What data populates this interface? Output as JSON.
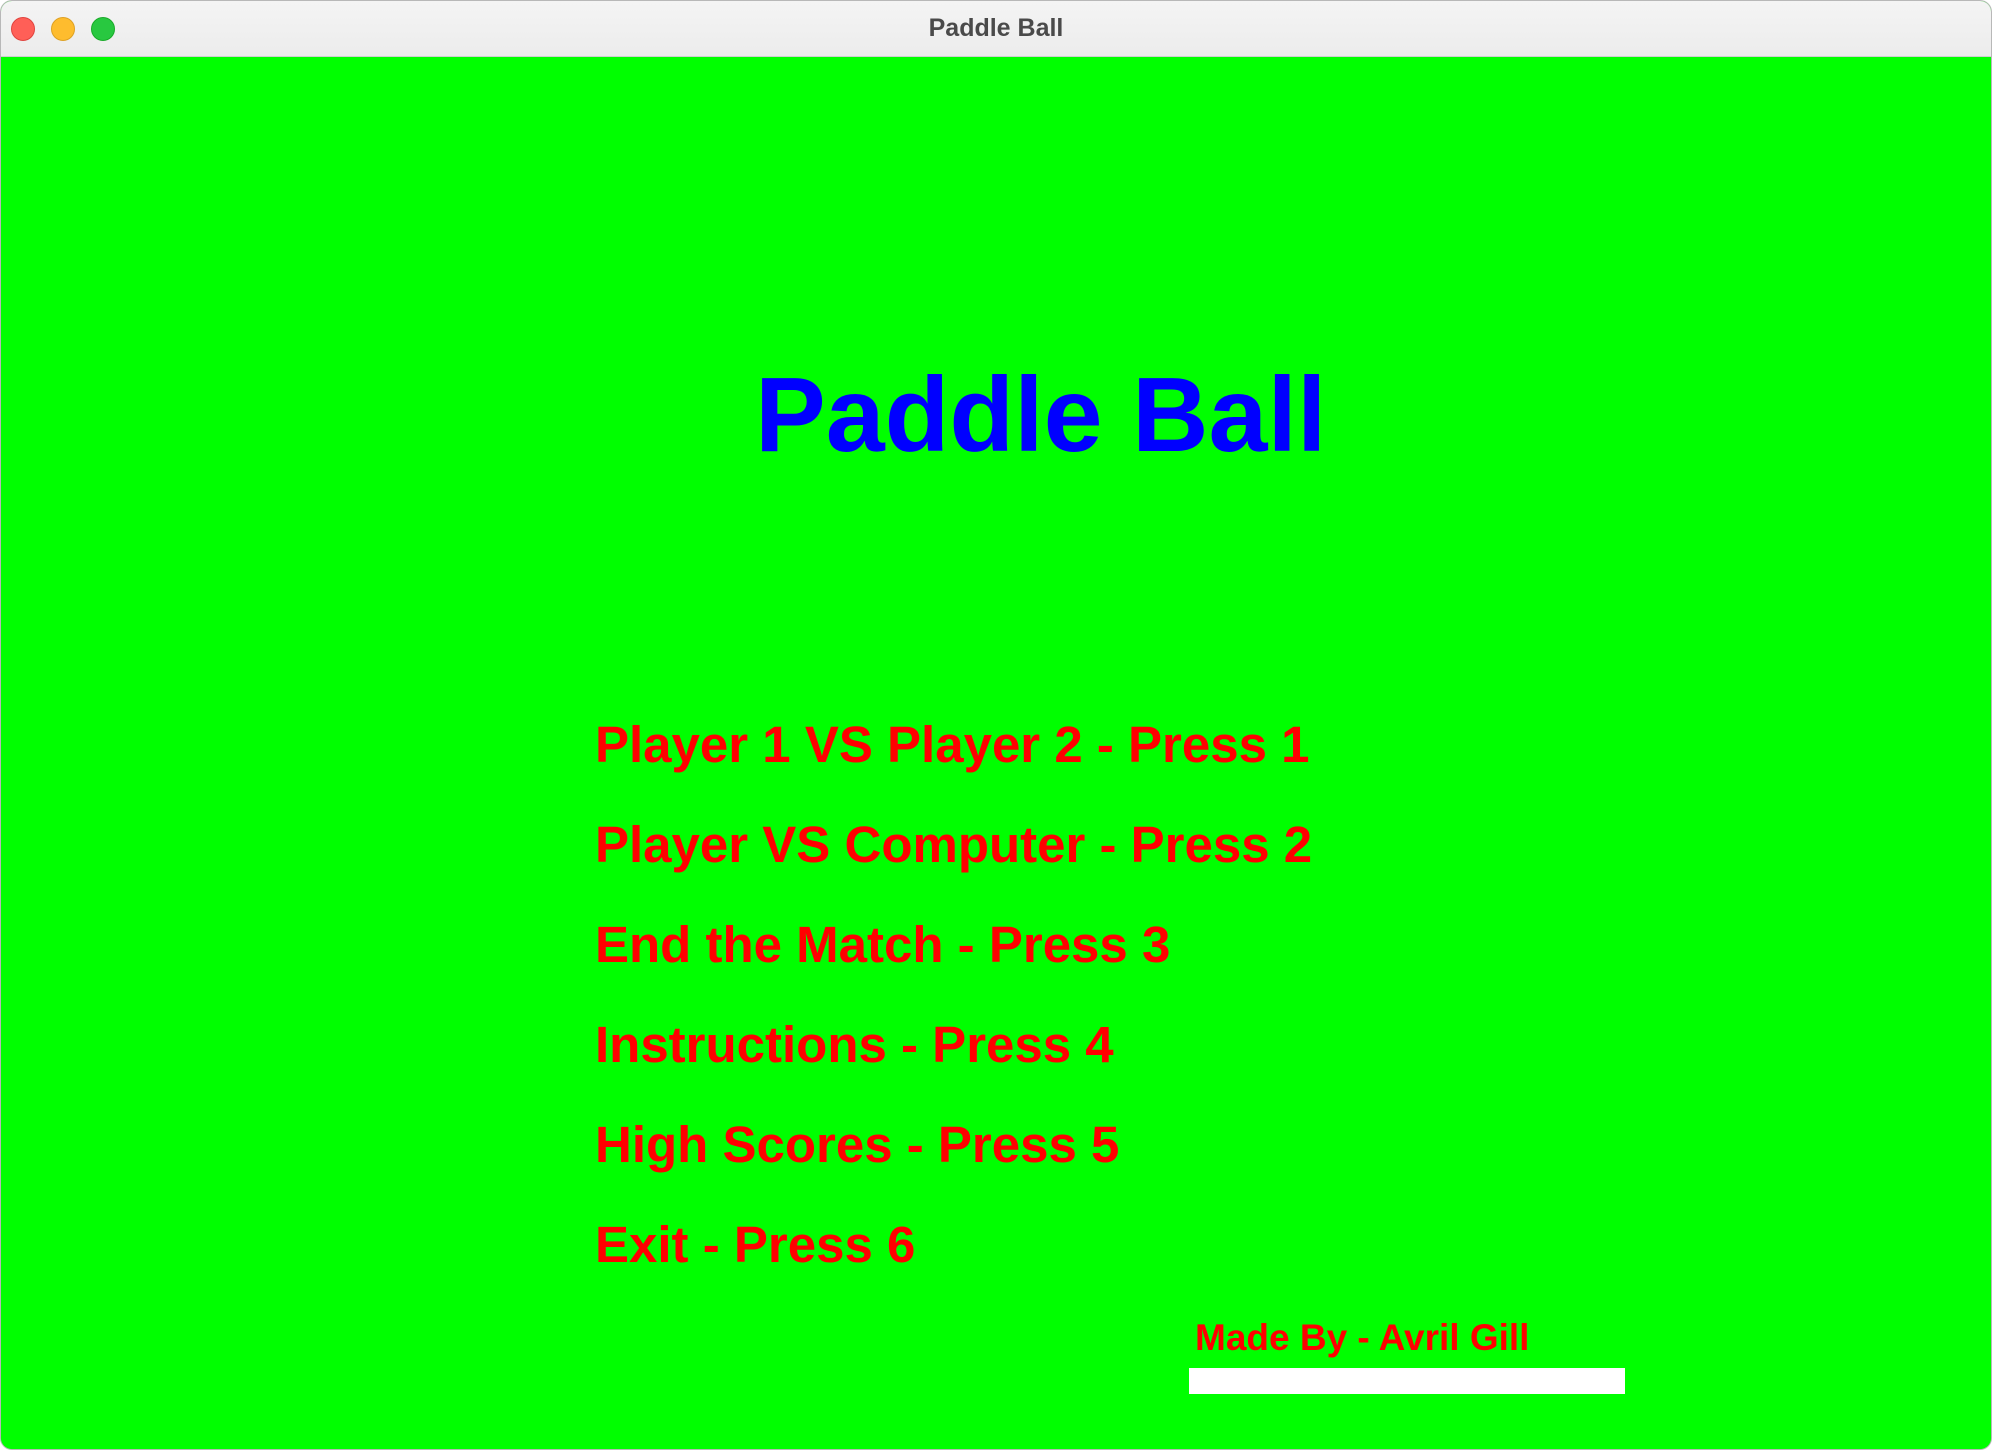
{
  "window": {
    "title": "Paddle Ball"
  },
  "game": {
    "title": "Paddle Ball",
    "menu": [
      {
        "label": "Player 1 VS Player 2 - Press 1"
      },
      {
        "label": "Player VS Computer - Press 2"
      },
      {
        "label": "End the Match - Press 3"
      },
      {
        "label": "Instructions - Press 4"
      },
      {
        "label": "High Scores - Press 5"
      },
      {
        "label": "Exit - Press 6"
      }
    ],
    "credit": "Made By - Avril Gill"
  },
  "colors": {
    "background": "#00ff00",
    "title": "#0000ff",
    "menu_text": "#ff0000",
    "credit_bar": "#ffffff"
  }
}
